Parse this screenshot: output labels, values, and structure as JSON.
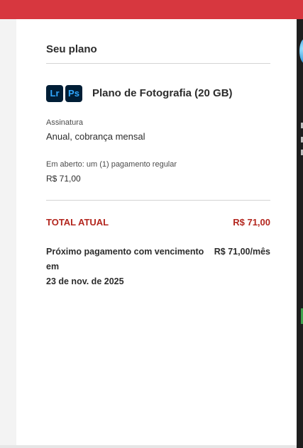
{
  "colors": {
    "top_bar": "#d7373f",
    "total_accent": "#b3261e",
    "app_icon_bg": "#001e36",
    "app_icon_fg": "#31a8ff"
  },
  "plan": {
    "section_title": "Seu plano",
    "apps": [
      {
        "icon": "lightroom-icon",
        "label": "Lr"
      },
      {
        "icon": "photoshop-icon",
        "label": "Ps"
      }
    ],
    "name": "Plano de Fotografia (20 GB)",
    "subscription_label": "Assinatura",
    "subscription_value": "Anual, cobrança mensal",
    "open_label": "Em aberto: um (1) pagamento regular",
    "open_value": "R$ 71,00"
  },
  "totals": {
    "total_label": "TOTAL ATUAL",
    "total_value": "R$ 71,00",
    "next_payment_label_line1": "Próximo pagamento com vencimento",
    "next_payment_label_line2": "em",
    "next_payment_date": "23 de nov. de 2025",
    "next_payment_value": "R$ 71,00/mês"
  }
}
